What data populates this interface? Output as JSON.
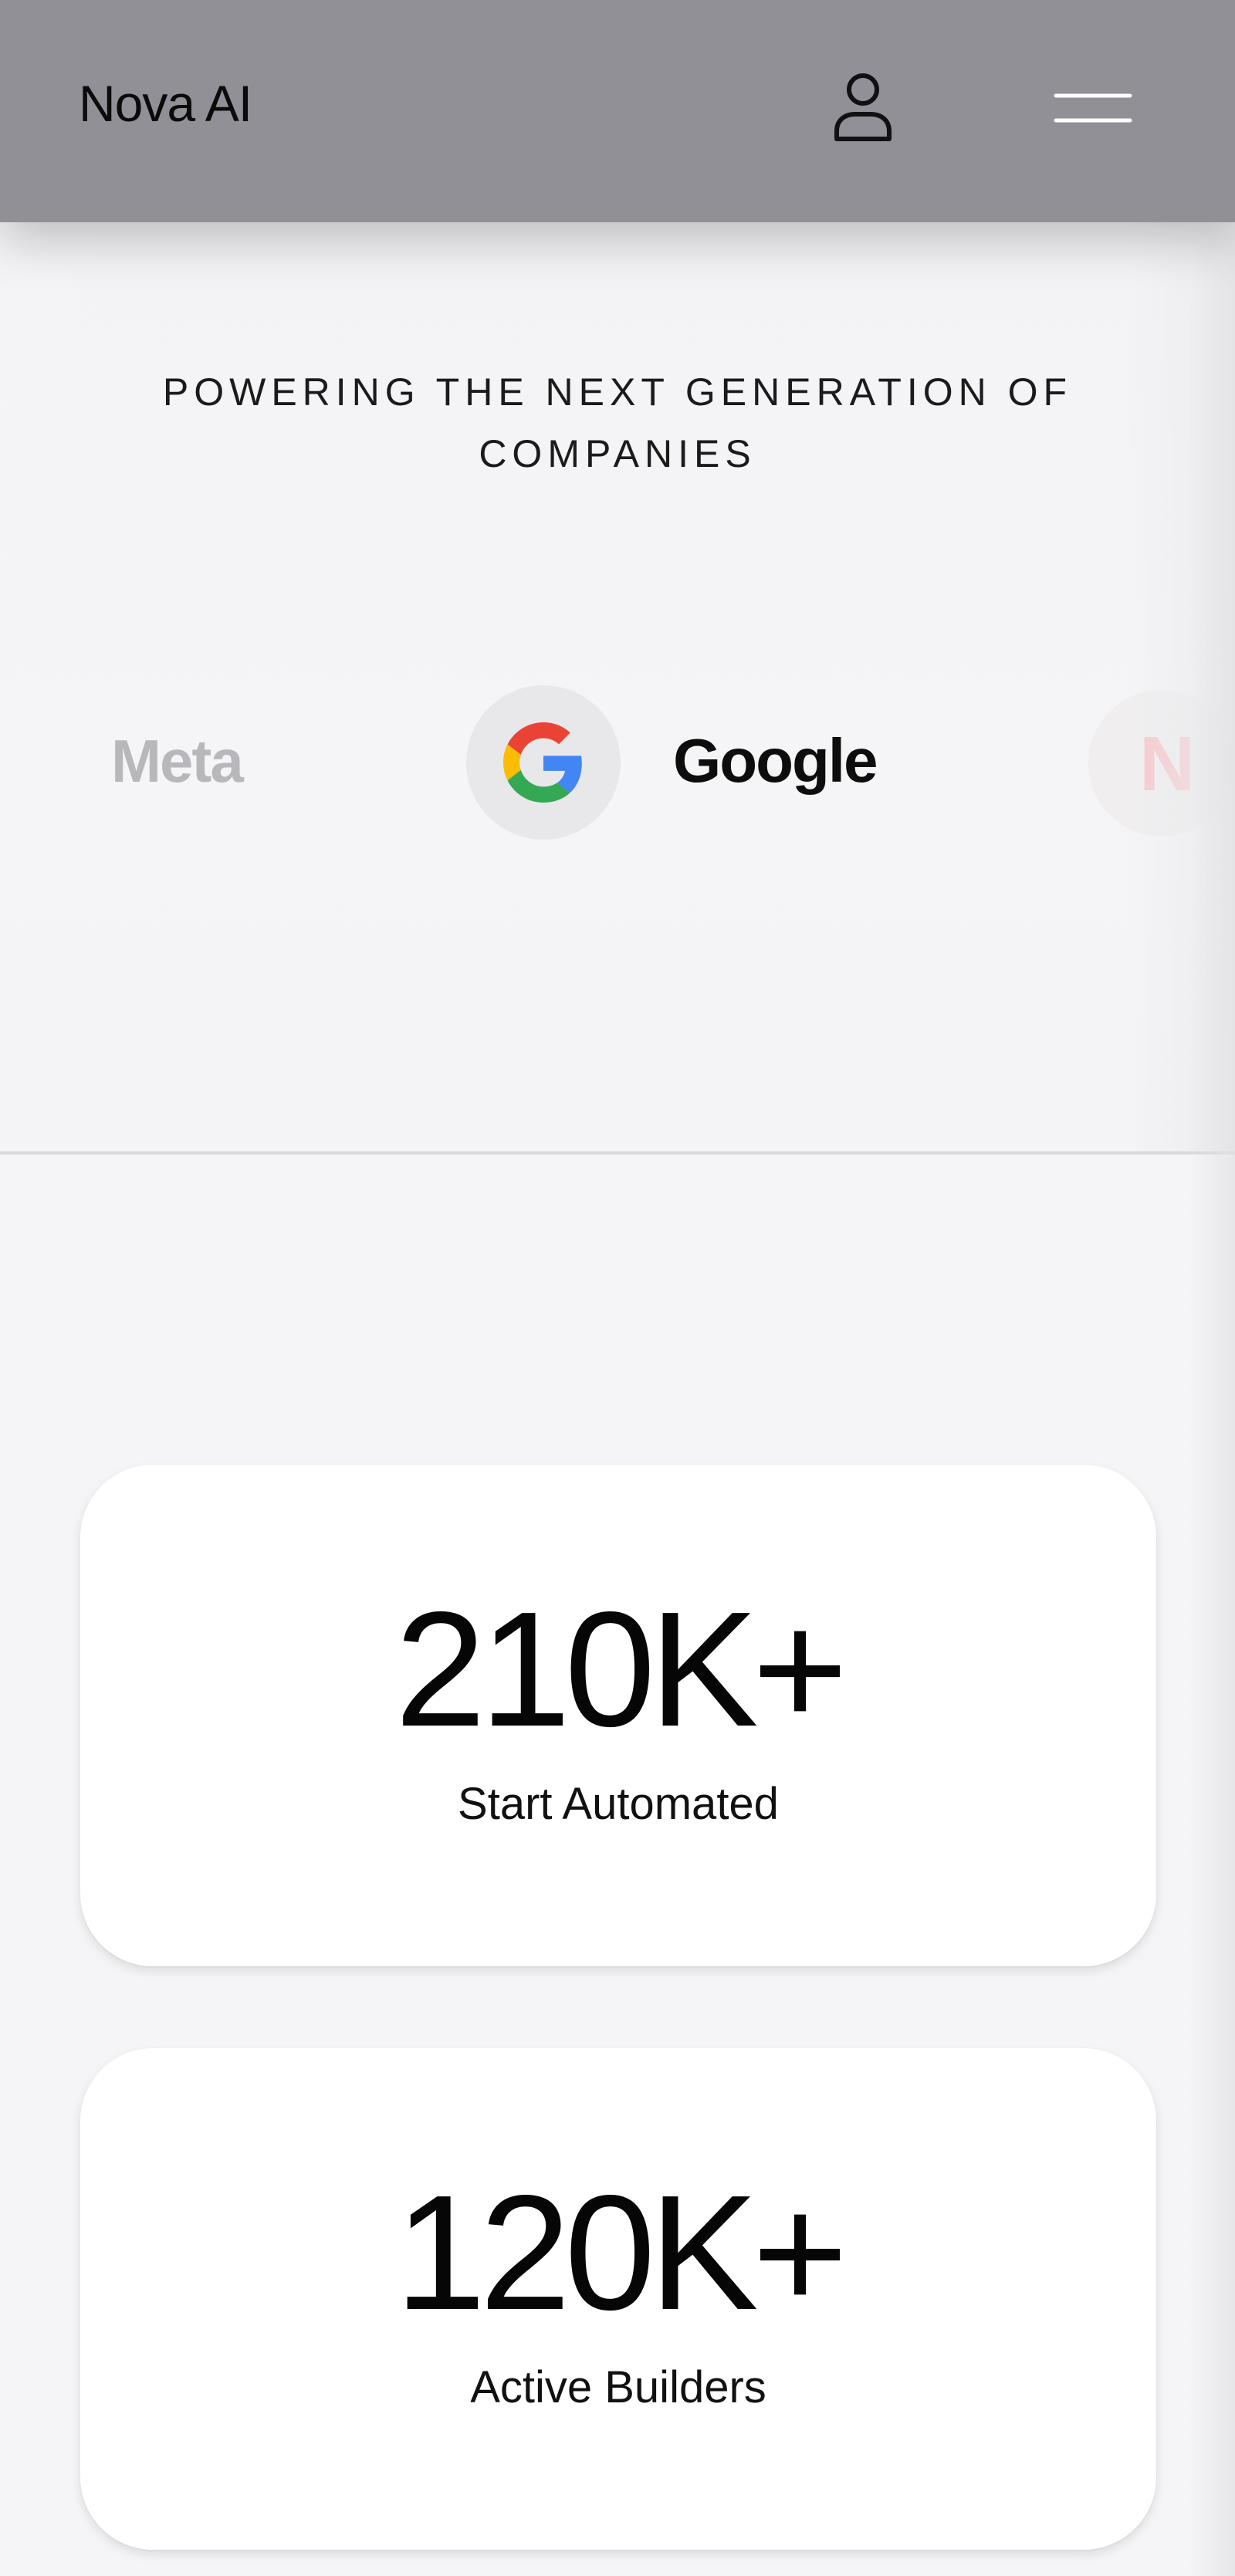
{
  "header": {
    "brand": "Nova AI",
    "icons": {
      "user": "user-icon",
      "menu": "hamburger-menu-icon"
    },
    "background": "#919096"
  },
  "companies": {
    "heading": "POWERING THE NEXT GENERATION OF COMPANIES",
    "logos": [
      {
        "name": "Meta"
      },
      {
        "name": "Google",
        "icon": "google-g-icon"
      },
      {
        "name": "N"
      }
    ]
  },
  "stats": [
    {
      "value": "210K+",
      "label": "Start Automated"
    },
    {
      "value": "120K+",
      "label": "Active Builders"
    }
  ],
  "colors": {
    "page_background": "#f5f5f7",
    "card_background": "#ffffff",
    "google_blue": "#4285F4",
    "google_red": "#EA4335",
    "google_yellow": "#FBBC05",
    "google_green": "#34A853"
  }
}
